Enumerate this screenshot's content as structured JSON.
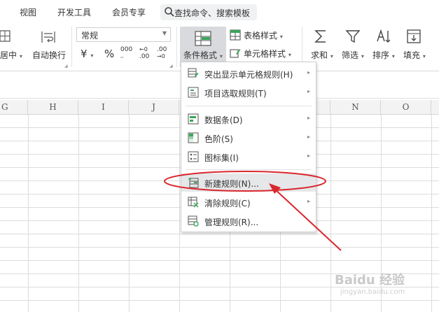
{
  "tabs": [
    "视图",
    "开发工具",
    "会员专享"
  ],
  "search": {
    "placeholder": "查找命令、搜索模板",
    "icon": "search-icon"
  },
  "ribbon": {
    "merge_label": "居中",
    "wrap_label": "自动换行",
    "number_format": "常规",
    "currency_symbol": "¥",
    "percent_symbol": "%",
    "thousands_symbol": "000",
    "increase_decimal": ".00",
    "decrease_decimal": ".00",
    "conditional_format_label": "条件格式",
    "table_style_label": "表格样式",
    "cell_style_label": "单元格样式",
    "sum_label": "求和",
    "filter_label": "筛选",
    "sort_label": "排序",
    "fill_label": "填充"
  },
  "columns": [
    "G",
    "H",
    "I",
    "J",
    "N",
    "O"
  ],
  "menu": {
    "items": [
      {
        "label": "突出显示单元格规则(H)",
        "submenu": true,
        "icon": "highlight-rules-icon"
      },
      {
        "label": "项目选取规则(T)",
        "submenu": true,
        "icon": "top-bottom-rules-icon"
      },
      {
        "label": "数据条(D)",
        "submenu": true,
        "icon": "data-bars-icon"
      },
      {
        "label": "色阶(S)",
        "submenu": true,
        "icon": "color-scales-icon"
      },
      {
        "label": "图标集(I)",
        "submenu": true,
        "icon": "icon-sets-icon"
      },
      {
        "label": "新建规则(N)...",
        "submenu": false,
        "icon": "new-rule-icon",
        "highlighted": true
      },
      {
        "label": "清除规则(C)",
        "submenu": true,
        "icon": "clear-rules-icon"
      },
      {
        "label": "管理规则(R)...",
        "submenu": false,
        "icon": "manage-rules-icon"
      }
    ]
  },
  "watermark": {
    "brand": "Baidu 经验",
    "sub": "jingyan.baidu.com"
  },
  "colors": {
    "annotation": "#d9272e",
    "highlight": "#e6e7e9",
    "button_active": "#d8dadd"
  }
}
